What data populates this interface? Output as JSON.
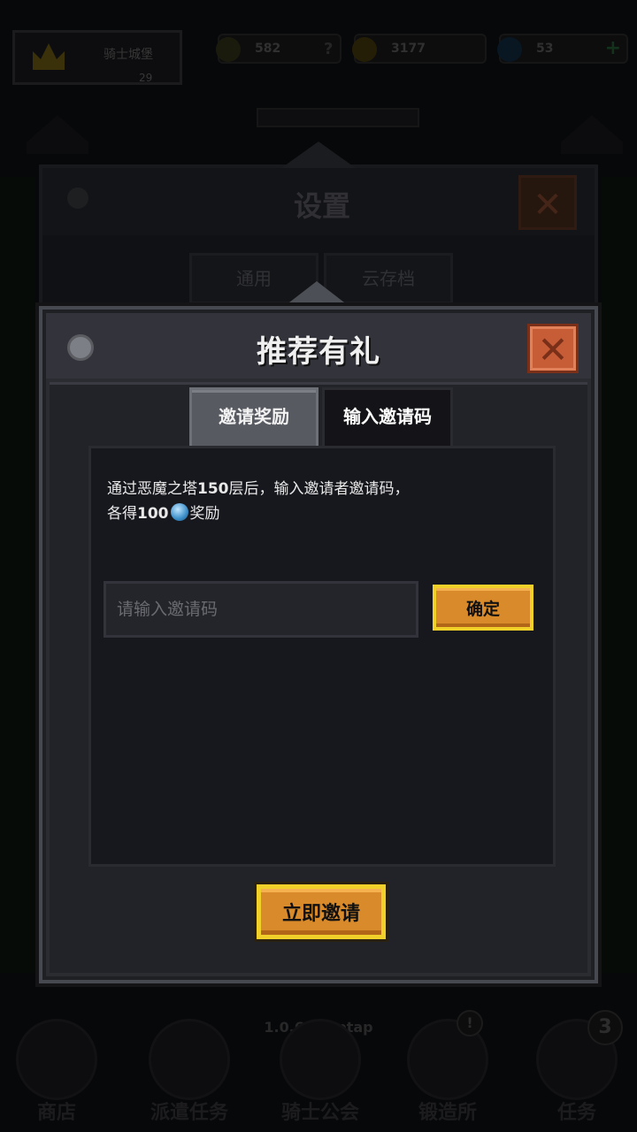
{
  "background": {
    "player": {
      "name": "骑士城堡",
      "level": "29"
    },
    "resources": [
      {
        "icon": "trophy-icon",
        "value": "582"
      },
      {
        "icon": "gold-coin-icon",
        "value": "3177"
      },
      {
        "icon": "gem-icon",
        "value": "53"
      }
    ],
    "settings_panel": {
      "title": "设置",
      "tabs": [
        "通用",
        "云存档"
      ]
    },
    "version": "1.0.67 Taptap",
    "bottom_nav": [
      {
        "label": "商店",
        "icon": "shop-icon",
        "badge": ""
      },
      {
        "label": "派遣任务",
        "icon": "dispatch-icon",
        "badge": ""
      },
      {
        "label": "骑士公会",
        "icon": "guild-icon",
        "badge": ""
      },
      {
        "label": "锻造所",
        "icon": "forge-icon",
        "badge": "!"
      },
      {
        "label": "任务",
        "icon": "quest-icon",
        "badge": "3"
      }
    ]
  },
  "dialog": {
    "title": "推荐有礼",
    "tabs": {
      "invite_reward": "邀请奖励",
      "enter_code": "输入邀请码"
    },
    "description": {
      "line1_prefix": "通过恶魔之塔",
      "line1_number": "150",
      "line1_suffix": "层后，输入邀请者邀请码，",
      "line2_prefix": "各得",
      "line2_number": "100",
      "line2_suffix": "奖励"
    },
    "code_input": {
      "placeholder": "请输入邀请码",
      "value": ""
    },
    "confirm_button": "确定",
    "invite_button": "立即邀请"
  },
  "colors": {
    "accent_gold": "#f2d02a",
    "button_orange": "#d98a2a",
    "close_red": "#c75d37",
    "gem_blue": "#3b8ec8"
  }
}
